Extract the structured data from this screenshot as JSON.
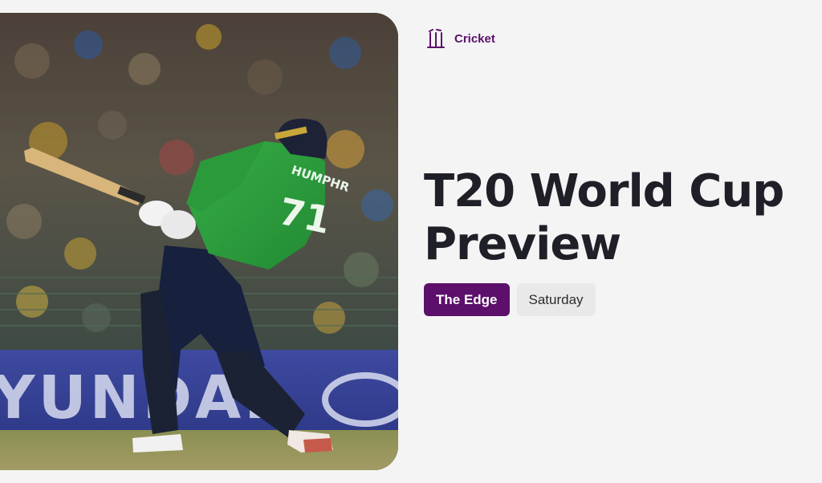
{
  "category": {
    "icon": "cricket-stumps-icon",
    "label": "Cricket"
  },
  "headline": "T20 World Cup Preview",
  "tags": [
    {
      "label": "The Edge"
    },
    {
      "label": "Saturday"
    }
  ],
  "hero_image": {
    "description_icon": "cricket-batsman-photo",
    "jersey_name": "HUMPHR",
    "jersey_number": "71",
    "board_text": "YUNDAI"
  },
  "colors": {
    "accent": "#5c0f6b",
    "background": "#f4f4f4",
    "headline": "#1f1f28",
    "secondary_tag_bg": "#e9e9e9",
    "jersey_green": "#2f9a3c"
  }
}
